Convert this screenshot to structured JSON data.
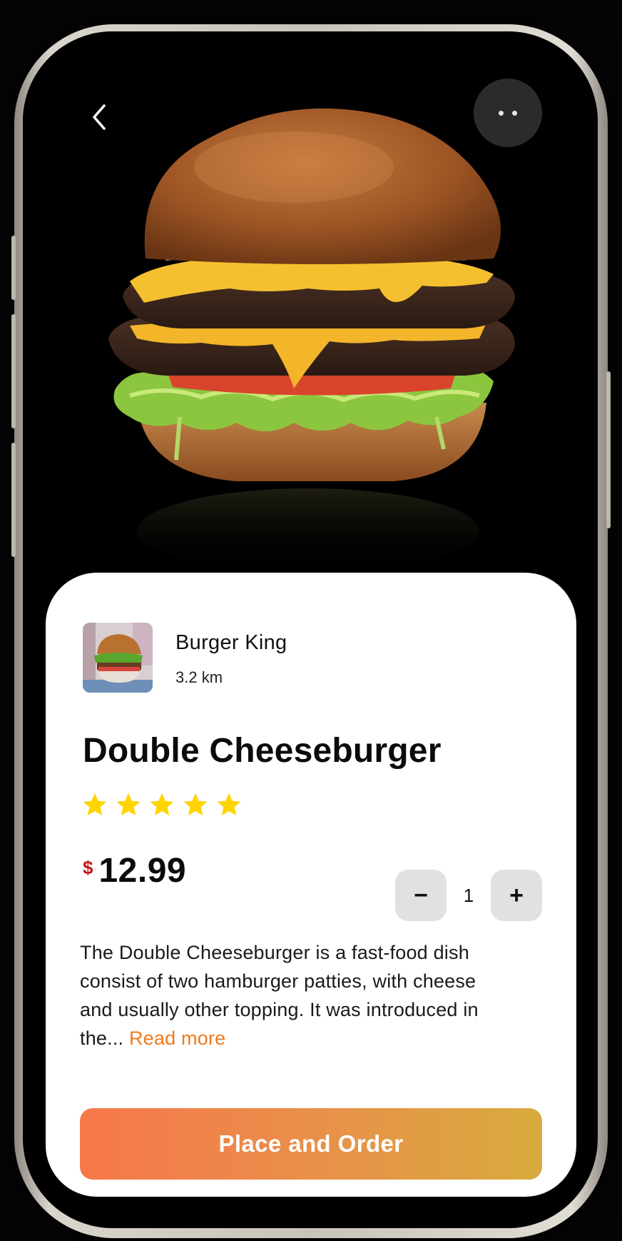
{
  "header": {
    "back_icon": "chevron-left-icon",
    "more_icon": "more-dots-icon"
  },
  "product_image": "double-cheeseburger-photo",
  "store": {
    "name": "Burger King",
    "distance": "3.2 km",
    "thumbnail": "burger-thumbnail"
  },
  "product": {
    "title": "Double Cheeseburger",
    "rating": 5,
    "rating_max": 5,
    "currency_symbol": "$",
    "price": "12.99",
    "star_color": "#ffd400"
  },
  "quantity": {
    "minus": "−",
    "value": "1",
    "plus": "+"
  },
  "description": {
    "text": "The Double Cheeseburger is a fast-food dish consist of two hamburger patties, with cheese and usually other topping. It was introduced in the...",
    "read_more": "Read more",
    "read_more_color": "#f07a1a"
  },
  "cta": {
    "label": "Place and Order",
    "gradient": [
      "#f7774a",
      "#d8ab3e"
    ]
  }
}
